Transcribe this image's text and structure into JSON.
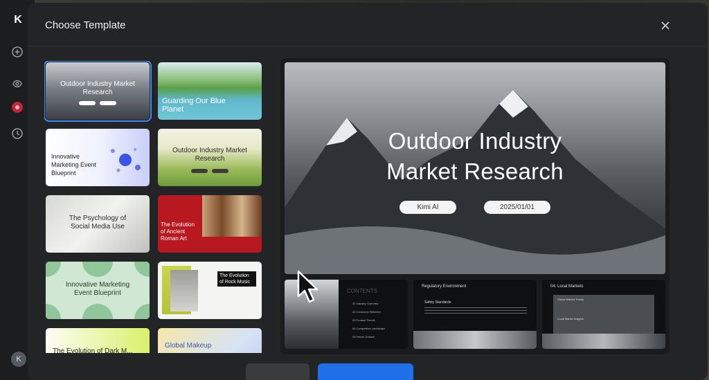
{
  "rail": {
    "logo": "K",
    "avatar": "K"
  },
  "modal": {
    "title": "Choose Template"
  },
  "templates": [
    {
      "title": "Outdoor Industry Market Research",
      "selected": true
    },
    {
      "title": "Guarding Our Blue Planet"
    },
    {
      "title": "Innovative Marketing Event Blueprint"
    },
    {
      "title": "Outdoor Industry Market Research"
    },
    {
      "title": "The Psychology of Social Media Use"
    },
    {
      "title": "The Evolution of Ancient Roman Art"
    },
    {
      "title": "Innovative Marketing Event Blueprint"
    },
    {
      "title": "The Evolution of Rock Music"
    },
    {
      "title": "The Evolution of Dark M..."
    },
    {
      "title": "Global Makeup"
    }
  ],
  "preview": {
    "title_line1": "Outdoor Industry",
    "title_line2": "Market Research",
    "author": "Kimi AI",
    "date": "2025/01/01",
    "thumbs": [
      {
        "heading": "CONTENTS",
        "items": [
          "01  Industry Overview",
          "02  Consumer Behavior",
          "03  Product Trends",
          "04  Competitive Landscape",
          "05  Future Outlook"
        ]
      },
      {
        "heading": "Regulatory Environment",
        "sub": "Safety Standards"
      },
      {
        "heading": "04. Local Markets",
        "sub1": "Global Market Trends",
        "sub2": "Local Market Insights"
      }
    ]
  }
}
